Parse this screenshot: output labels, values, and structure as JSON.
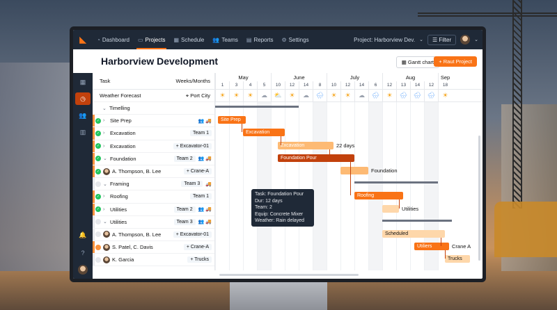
{
  "nav": {
    "items": [
      {
        "label": "Dashboard",
        "icon": "dashboard-icon"
      },
      {
        "label": "Projects",
        "icon": "folder-icon",
        "active": true
      },
      {
        "label": "Schedule",
        "icon": "calendar-icon"
      },
      {
        "label": "Teams",
        "icon": "teams-icon"
      },
      {
        "label": "Reports",
        "icon": "reports-icon"
      },
      {
        "label": "Settings",
        "icon": "gear-icon"
      }
    ],
    "project_label": "Project: Harborview Dev.",
    "filter_label": "Filter"
  },
  "page": {
    "title": "Harborview Development",
    "gantt_button": "Gantt chart",
    "primary_button": "+ Raut Project"
  },
  "tasklist": {
    "col_task": "Task",
    "col_weeks": "Weeks/Months",
    "weather_label": "Weather Forecast",
    "weather_location": "Port City",
    "rows": [
      {
        "label": "Timelling",
        "tag": "",
        "icons": "",
        "check": "none",
        "chev": "⌄",
        "indent": true
      },
      {
        "label": "Site Prep",
        "tag": "",
        "icons": "👥 🚚",
        "check": "done",
        "chev": "›"
      },
      {
        "label": "Excavation",
        "tag": "Team 1",
        "icons": "",
        "check": "done",
        "chev": "›"
      },
      {
        "label": "Excavation",
        "tag": "+ Excavator-01",
        "icons": "",
        "check": "done",
        "chev": "›"
      },
      {
        "label": "Foundation",
        "tag": "Team 2",
        "icons": "👥 🚚",
        "check": "done",
        "chev": "⌄"
      },
      {
        "label": "A. Thompson, B. Lee",
        "tag": "+ Crane-A",
        "icons": "",
        "check": "done",
        "chev": "",
        "person": true
      },
      {
        "label": "Framing",
        "tag": "Team 3",
        "icons": "🚚",
        "check": "pending",
        "chev": "⌄"
      },
      {
        "label": "Roofing",
        "tag": "Team 1",
        "icons": "",
        "check": "done",
        "chev": "›"
      },
      {
        "label": "Utilities",
        "tag": "Team 2",
        "icons": "👥 🚚",
        "check": "done",
        "chev": "›"
      },
      {
        "label": "Utilities",
        "tag": "Team 3",
        "icons": "👥 🚚",
        "check": "pending",
        "chev": "⌄"
      },
      {
        "label": "A. Thompson, B. Lee",
        "tag": "+ Excavator-01",
        "icons": "",
        "check": "pending",
        "chev": "",
        "person": true
      },
      {
        "label": "S. Patel, C. Davis",
        "tag": "+ Crane-A",
        "icons": "",
        "check": "warn",
        "chev": "",
        "person": true
      },
      {
        "label": "K. Garcia",
        "tag": "+ Trucks",
        "icons": "",
        "check": "pending",
        "chev": "",
        "person": true
      }
    ]
  },
  "timeline": {
    "months": [
      "May",
      "June",
      "July",
      "Aug",
      "Sep"
    ],
    "days": [
      "1",
      "3",
      "4",
      "5",
      "10",
      "12",
      "14",
      "8",
      "10",
      "12",
      "14",
      "6",
      "12",
      "13",
      "14",
      "12",
      "18"
    ],
    "weather": [
      "sun",
      "sun",
      "sun",
      "cloud",
      "partly",
      "sun",
      "cloud",
      "rain",
      "sun",
      "sun",
      "cloud",
      "rain",
      "sun",
      "rain",
      "rain",
      "rain",
      "sun"
    ],
    "bars": [
      {
        "label": "Site Prep",
        "start": 0.2,
        "len": 2.0,
        "row": 1,
        "color": "#f97316"
      },
      {
        "label": "Excavation",
        "start": 2.0,
        "len": 3.0,
        "row": 2,
        "color": "#f97316"
      },
      {
        "label": "Excavation",
        "start": 4.5,
        "len": 4.0,
        "row": 3,
        "color": "#fdba74",
        "after": "22 days"
      },
      {
        "label": "Foundation Pour",
        "start": 4.5,
        "len": 5.5,
        "row": 4,
        "color": "#c2410c"
      },
      {
        "label": "",
        "start": 9.0,
        "len": 2.0,
        "row": 5,
        "color": "#fdba74",
        "after": "Foundation"
      },
      {
        "label": "Roofing",
        "start": 10.0,
        "len": 3.5,
        "row": 7,
        "color": "#f97316"
      },
      {
        "label": "",
        "start": 12.0,
        "len": 1.2,
        "row": 8,
        "color": "#fed7aa",
        "after": "Utilities"
      },
      {
        "label": "Scheduled",
        "start": 12.0,
        "len": 4.5,
        "row": 10,
        "color": "#fed7aa",
        "dark": true
      },
      {
        "label": "Utiliers",
        "start": 14.3,
        "len": 2.5,
        "row": 11,
        "color": "#f97316",
        "after": "Crane A"
      },
      {
        "label": "Trucks",
        "start": 16.5,
        "len": 1.8,
        "row": 12,
        "color": "#fed7aa",
        "dark": true
      }
    ],
    "summaries": [
      {
        "start": 0.0,
        "len": 6.0,
        "row": 0
      },
      {
        "start": 10.0,
        "len": 6.0,
        "row": 6
      },
      {
        "start": 12.0,
        "len": 5.0,
        "row": 9
      }
    ]
  },
  "tooltip": {
    "lines": [
      "Task: Foundation Pour",
      "Dur: 12 days",
      "Team: 2",
      "Equip: Concrete Mixer",
      "Weather: Rain delayed"
    ]
  }
}
